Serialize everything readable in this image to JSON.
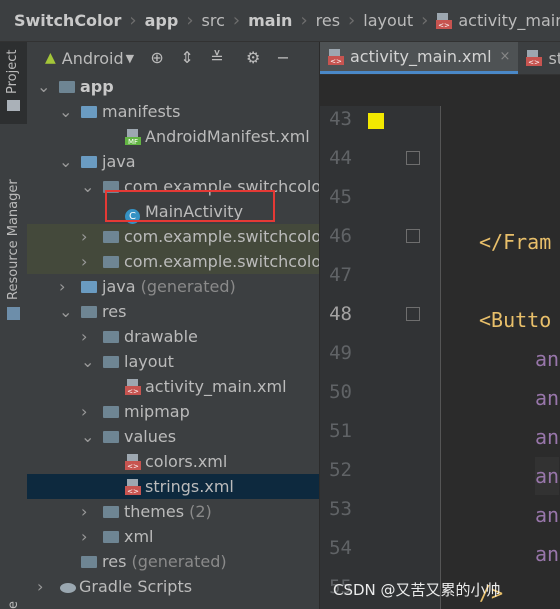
{
  "breadcrumb": [
    "SwitchColor",
    "app",
    "src",
    "main",
    "res",
    "layout",
    "activity_main.xml"
  ],
  "strip": {
    "project": "Project",
    "resource_manager": "Resource Manager",
    "bottom_cut": "e"
  },
  "panel": {
    "view_mode": "Android",
    "tree": [
      {
        "label": "app",
        "indent": 0,
        "chev": "⌄",
        "icon": "module",
        "bold": true
      },
      {
        "label": "manifests",
        "indent": 1,
        "chev": "⌄",
        "icon": "folder-blue"
      },
      {
        "label": "AndroidManifest.xml",
        "indent": 3,
        "chev": "",
        "icon": "mf"
      },
      {
        "label": "java",
        "indent": 1,
        "chev": "⌄",
        "icon": "folder-blue"
      },
      {
        "label": "com.example.switchcolor",
        "indent": 2,
        "chev": "⌄",
        "icon": "folder"
      },
      {
        "label": "MainActivity",
        "indent": 3,
        "chev": "",
        "icon": "class"
      },
      {
        "label": "com.example.switchcolor (",
        "indent": 2,
        "chev": "›",
        "icon": "folder",
        "hl": true
      },
      {
        "label": "com.example.switchcolor (",
        "indent": 2,
        "chev": "›",
        "icon": "folder",
        "hl": true
      },
      {
        "label": "java",
        "suffix": " (generated)",
        "indent": 1,
        "chev": "›",
        "icon": "folder-blue"
      },
      {
        "label": "res",
        "indent": 1,
        "chev": "⌄",
        "icon": "folder"
      },
      {
        "label": "drawable",
        "indent": 2,
        "chev": "›",
        "icon": "folder"
      },
      {
        "label": "layout",
        "indent": 2,
        "chev": "⌄",
        "icon": "folder"
      },
      {
        "label": "activity_main.xml",
        "indent": 3,
        "chev": "",
        "icon": "xml"
      },
      {
        "label": "mipmap",
        "indent": 2,
        "chev": "›",
        "icon": "folder"
      },
      {
        "label": "values",
        "indent": 2,
        "chev": "⌄",
        "icon": "folder"
      },
      {
        "label": "colors.xml",
        "indent": 3,
        "chev": "",
        "icon": "xml"
      },
      {
        "label": "strings.xml",
        "indent": 3,
        "chev": "",
        "icon": "xml",
        "sel": true
      },
      {
        "label": "themes",
        "suffix": " (2)",
        "indent": 2,
        "chev": "›",
        "icon": "folder"
      },
      {
        "label": "xml",
        "indent": 2,
        "chev": "›",
        "icon": "folder"
      },
      {
        "label": "res",
        "suffix": " (generated)",
        "indent": 1,
        "chev": "",
        "icon": "folder"
      },
      {
        "label": "Gradle Scripts",
        "indent": 0,
        "chev": "›",
        "icon": "gradle"
      }
    ]
  },
  "editor": {
    "tabs": [
      {
        "label": "activity_main.xml",
        "active": true,
        "close": "×"
      },
      {
        "label": "str",
        "active": false
      }
    ],
    "lines": [
      {
        "n": "43",
        "text": "",
        "cls": ""
      },
      {
        "n": "44",
        "text": "",
        "cls": ""
      },
      {
        "n": "45",
        "text": "",
        "cls": ""
      },
      {
        "n": "46",
        "text": "</Fram",
        "cls": "tag"
      },
      {
        "n": "47",
        "text": "",
        "cls": ""
      },
      {
        "n": "48",
        "text": "<Butto",
        "cls": "tag"
      },
      {
        "n": "49",
        "text": "an",
        "cls": "attr"
      },
      {
        "n": "50",
        "text": "an",
        "cls": "attr"
      },
      {
        "n": "51",
        "text": "an",
        "cls": "attr"
      },
      {
        "n": "52",
        "text": "an",
        "cls": "attr"
      },
      {
        "n": "53",
        "text": "an",
        "cls": "attr"
      },
      {
        "n": "54",
        "text": "an",
        "cls": "attr"
      },
      {
        "n": "55",
        "text": "/>",
        "cls": "tag"
      }
    ]
  },
  "watermark": "CSDN @又苦又累的小帅"
}
